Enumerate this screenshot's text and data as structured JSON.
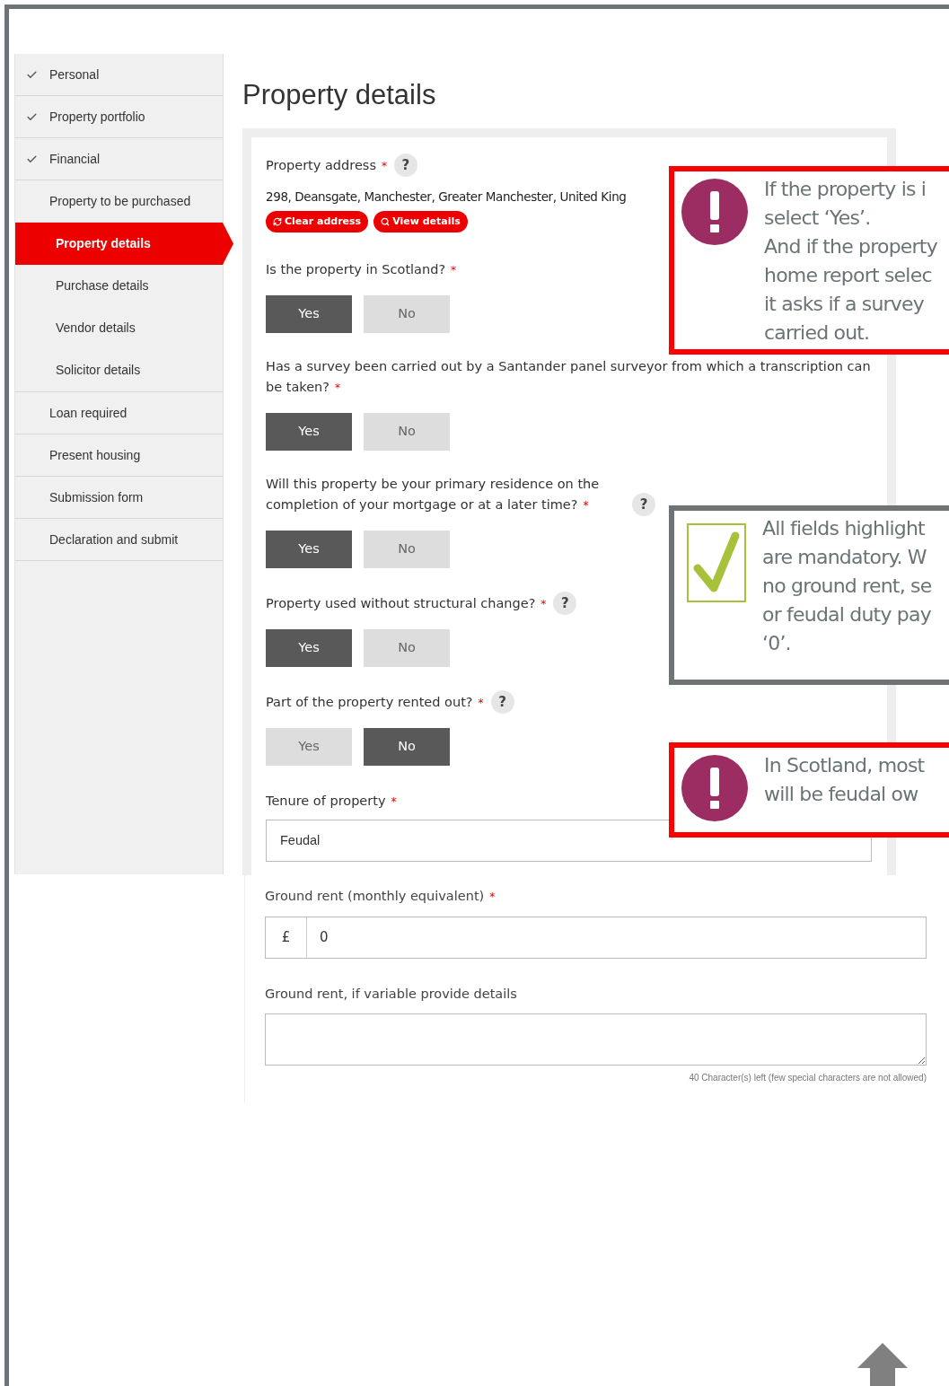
{
  "sidebar": {
    "items": [
      {
        "label": "Personal",
        "checked": true,
        "selected": false
      },
      {
        "label": "Property portfolio",
        "checked": true,
        "selected": false
      },
      {
        "label": "Financial",
        "checked": true,
        "selected": false
      },
      {
        "label": "Property to be purchased",
        "checked": false,
        "selected": false,
        "children": [
          {
            "label": "Property details",
            "selected": true
          },
          {
            "label": "Purchase details",
            "selected": false
          },
          {
            "label": "Vendor details",
            "selected": false
          },
          {
            "label": "Solicitor details",
            "selected": false
          }
        ]
      },
      {
        "label": "Loan required",
        "checked": false,
        "selected": false
      },
      {
        "label": "Present housing",
        "checked": false,
        "selected": false
      },
      {
        "label": "Submission form",
        "checked": false,
        "selected": false
      },
      {
        "label": "Declaration and submit",
        "checked": false,
        "selected": false
      }
    ]
  },
  "page_title": "Property details",
  "address": {
    "label": "Property address",
    "required": "*",
    "help": "?",
    "value": "298, Deansgate, Manchester, Greater Manchester, United King",
    "buttons": [
      {
        "kind": "clear",
        "label": "Clear address"
      },
      {
        "kind": "view",
        "label": "View details"
      }
    ]
  },
  "questions": [
    {
      "label": "Is the property in Scotland?",
      "required": "*",
      "options": [
        {
          "label": "Yes",
          "selected": true
        },
        {
          "label": "No",
          "selected": false
        }
      ]
    },
    {
      "label": "Has a survey been carried out by a Santander panel surveyor from which a transcription can be taken?",
      "required": "*",
      "options": [
        {
          "label": "Yes",
          "selected": true
        },
        {
          "label": "No",
          "selected": false
        }
      ]
    },
    {
      "label": "Will this property be your primary residence on the completion of your mortgage or at a later time?",
      "required": "*",
      "help": "?",
      "options": [
        {
          "label": "Yes",
          "selected": true
        },
        {
          "label": "No",
          "selected": false
        }
      ]
    },
    {
      "label": "Property used without structural change?",
      "required": "*",
      "help": "?",
      "options": [
        {
          "label": "Yes",
          "selected": true
        },
        {
          "label": "No",
          "selected": false
        }
      ]
    },
    {
      "label": "Part of the property rented out?",
      "required": "*",
      "help": "?",
      "options": [
        {
          "label": "Yes",
          "selected": false
        },
        {
          "label": "No",
          "selected": true
        }
      ]
    }
  ],
  "tenure": {
    "label": "Tenure of property",
    "required": "*",
    "value": "Feudal"
  },
  "ground_rent": {
    "label": "Ground rent (monthly equivalent)",
    "required": "*",
    "prefix": "£",
    "value": "0"
  },
  "ground_rent_details": {
    "label": "Ground rent, if variable provide details",
    "counter": "40 Character(s) left (few special characters are not allowed)"
  },
  "callouts": [
    {
      "kind": "warning",
      "lines": [
        "If the property is i",
        "select ‘Yes’.",
        "And if the property",
        "home report selec",
        "it asks if a survey",
        "carried out."
      ]
    },
    {
      "kind": "tip",
      "lines": [
        "All fields highlight",
        "are mandatory. W",
        "no ground rent, se",
        "or feudal duty pay",
        "‘0’."
      ]
    },
    {
      "kind": "warning",
      "lines": [
        "In Scotland, most",
        "will be feudal ow"
      ]
    }
  ]
}
